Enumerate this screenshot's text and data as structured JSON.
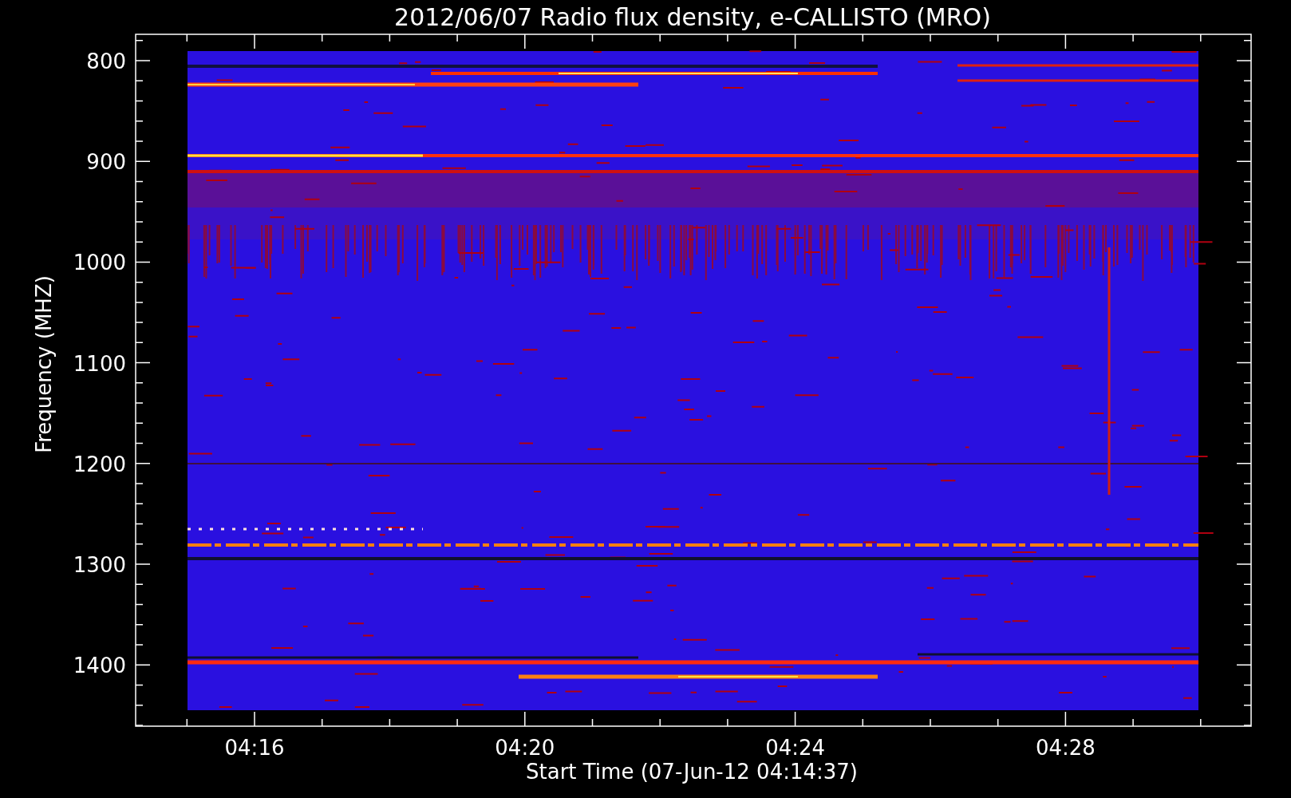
{
  "title": "2012/06/07  Radio flux density, e-CALLISTO (MRO)",
  "y_axis": {
    "label": "Frequency (MHZ)",
    "ticks": [
      "800",
      "900",
      "1000",
      "1100",
      "1200",
      "1300",
      "1400"
    ]
  },
  "x_axis": {
    "label": "Start Time (07-Jun-12 04:14:37)",
    "ticks": [
      "04:16",
      "04:20",
      "04:24",
      "04:28"
    ]
  }
}
